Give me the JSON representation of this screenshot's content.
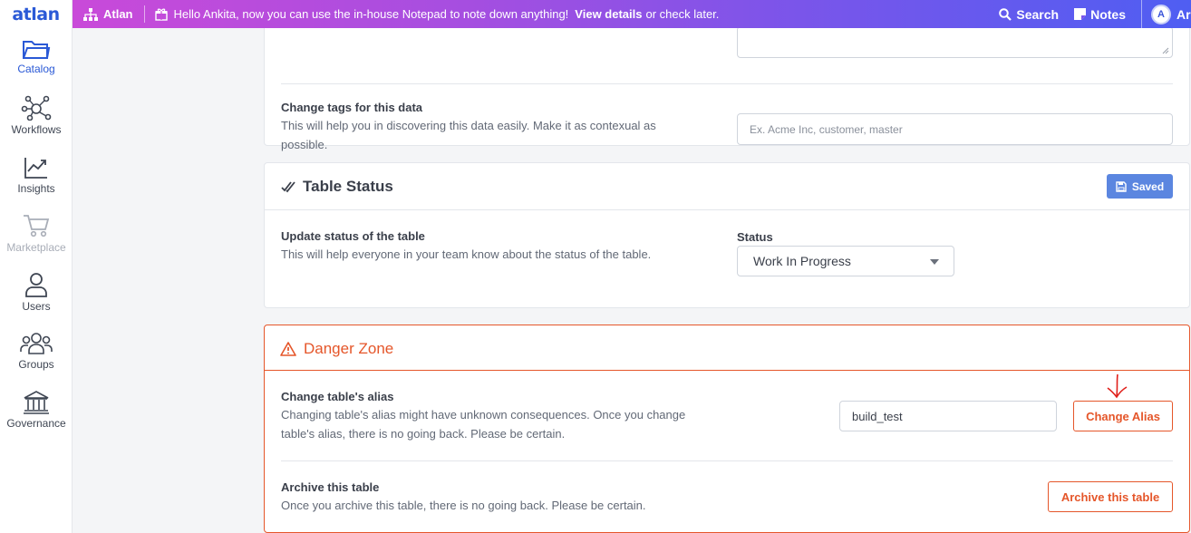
{
  "topbar": {
    "logo": "atlan",
    "brand": "Atlan",
    "message_prefix": "Hello Ankita, now you can use the in-house Notepad to note down anything!",
    "message_link": "View details",
    "message_suffix": "or check later.",
    "search_label": "Search",
    "notes_label": "Notes",
    "avatar_initial": "A",
    "avatar_name": "Ar"
  },
  "sidebar": {
    "items": [
      {
        "label": "Catalog",
        "icon": "folder-icon"
      },
      {
        "label": "Workflows",
        "icon": "workflow-icon"
      },
      {
        "label": "Insights",
        "icon": "chart-icon"
      },
      {
        "label": "Marketplace",
        "icon": "cart-icon"
      },
      {
        "label": "Users",
        "icon": "user-icon"
      },
      {
        "label": "Groups",
        "icon": "group-icon"
      },
      {
        "label": "Governance",
        "icon": "governance-icon"
      }
    ]
  },
  "tags_section": {
    "title": "Change tags for this data",
    "description": "This will help you in discovering this data easily. Make it as contexual as possible.",
    "placeholder": "Ex. Acme Inc, customer, master"
  },
  "status_card": {
    "title": "Table Status",
    "saved_label": "Saved",
    "row_title": "Update status of the table",
    "row_description": "This will help everyone in your team know about the status of the table.",
    "status_label": "Status",
    "status_value": "Work In Progress"
  },
  "danger_card": {
    "title": "Danger Zone",
    "alias_title": "Change table's alias",
    "alias_description": "Changing table's alias might have unknown consequences. Once you change table's alias, there is no going back. Please be certain.",
    "alias_value": "build_test",
    "alias_button": "Change Alias",
    "archive_title": "Archive this table",
    "archive_description": "Once you archive this table, there is no going back. Please be certain.",
    "archive_button": "Archive this table"
  },
  "colors": {
    "accent": "#2a59d6",
    "danger": "#e5562a",
    "saved": "#5b86e0",
    "annotation": "#e0201b"
  }
}
